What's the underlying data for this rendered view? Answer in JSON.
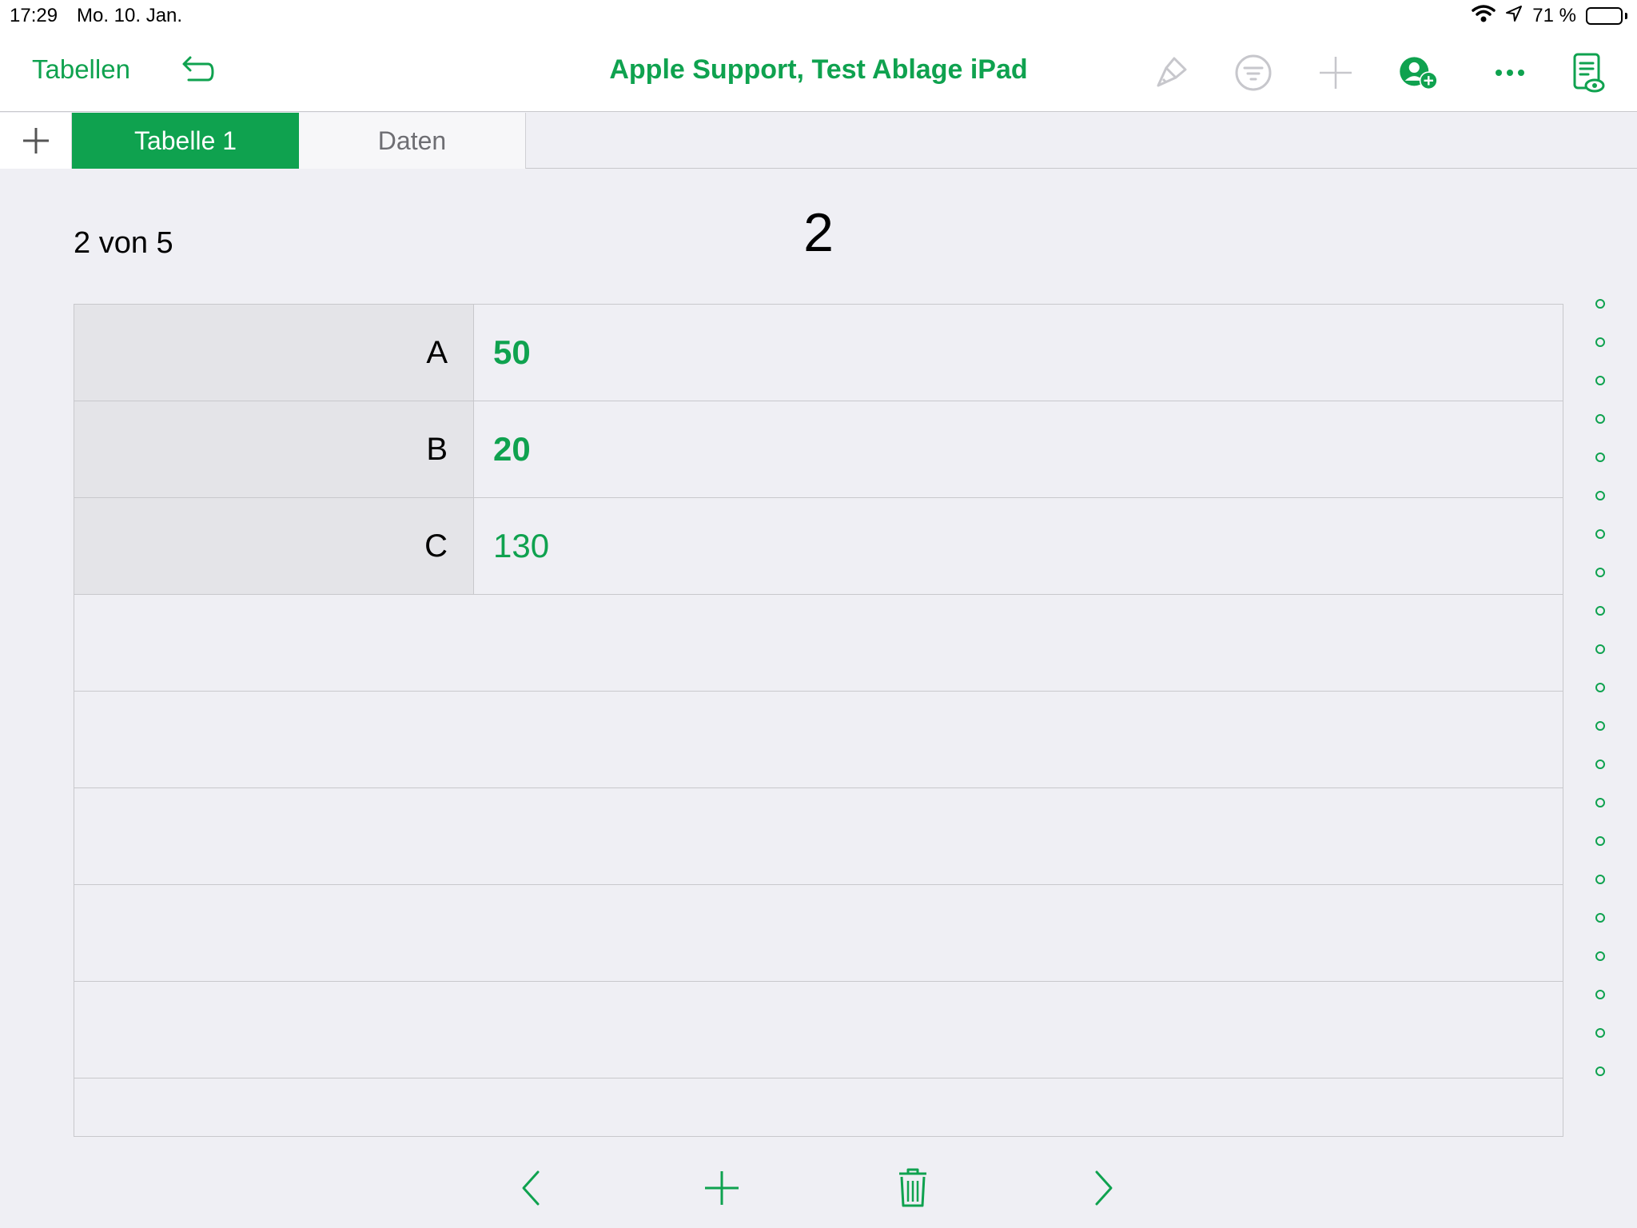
{
  "status_bar": {
    "time": "17:29",
    "date": "Mo. 10. Jan.",
    "battery_percent": "71 %",
    "battery_level": 0.71
  },
  "toolbar": {
    "back_label": "Tabellen",
    "document_title": "Apple Support, Test Ablage iPad"
  },
  "tabs": [
    {
      "label": "Tabelle 1",
      "active": true
    },
    {
      "label": "Daten",
      "active": false
    }
  ],
  "record": {
    "counter": "2 von 5",
    "title": "2"
  },
  "fields": [
    {
      "label": "A",
      "value": "50"
    },
    {
      "label": "B",
      "value": "20"
    },
    {
      "label": "C",
      "value": "130"
    }
  ],
  "colors": {
    "accent": "#0fa24f",
    "background": "#efeff4",
    "label_cell": "#e4e4e8"
  }
}
